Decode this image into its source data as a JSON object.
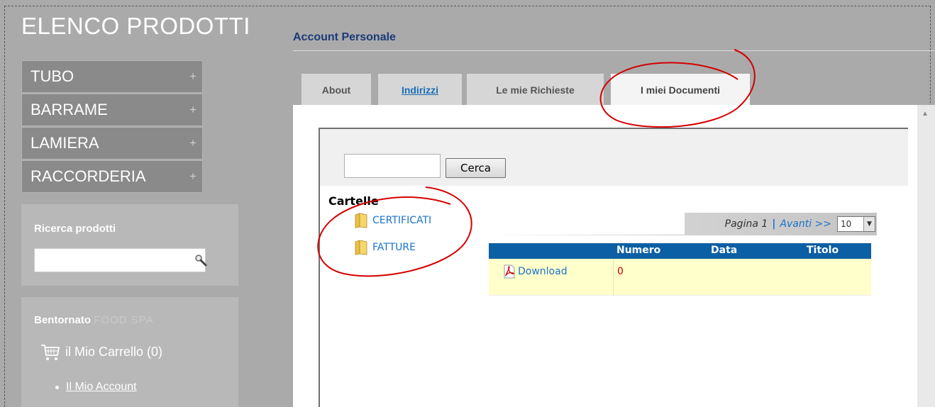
{
  "site": {
    "title": "ELENCO PRODOTTI"
  },
  "categories": [
    {
      "label": "TUBO",
      "expand": "+"
    },
    {
      "label": "BARRAME",
      "expand": "+"
    },
    {
      "label": "LAMIERA",
      "expand": "+"
    },
    {
      "label": "RACCORDERIA",
      "expand": "+"
    }
  ],
  "product_search": {
    "title": "Ricerca prodotti",
    "value": ""
  },
  "account": {
    "welcome": "Bentornato",
    "user_name": "FOOD SPA",
    "cart_label": "il Mio Carrello (0)",
    "links": [
      "Il Mio Account"
    ]
  },
  "section": {
    "title": "Account Personale"
  },
  "tabs": [
    {
      "label": "About"
    },
    {
      "label": "Indirizzi"
    },
    {
      "label": "Le mie Richieste"
    },
    {
      "label": "I miei Documenti"
    }
  ],
  "documents": {
    "search_value": "",
    "search_button": "Cerca",
    "folders_label": "Cartelle",
    "folders": [
      "CERTIFICATI",
      "FATTURE"
    ],
    "pager": {
      "page_text": "Pagina 1",
      "separator": "|",
      "next_label": "Avanti >>",
      "page_size": "10"
    },
    "columns": [
      "Numero",
      "Data",
      "Titolo"
    ],
    "rows": [
      {
        "link": "Download",
        "numero": "0",
        "data": "",
        "titolo": ""
      }
    ]
  },
  "colors": {
    "header_blue": "#0b5fa4",
    "link_blue": "#1a73c9",
    "row_yellow": "#ffffcc",
    "annotation_red": "#d40000"
  },
  "icons": {
    "folder": "folder-icon",
    "pdf": "pdf-icon",
    "cart": "cart-icon",
    "search": "magnifier-icon"
  }
}
